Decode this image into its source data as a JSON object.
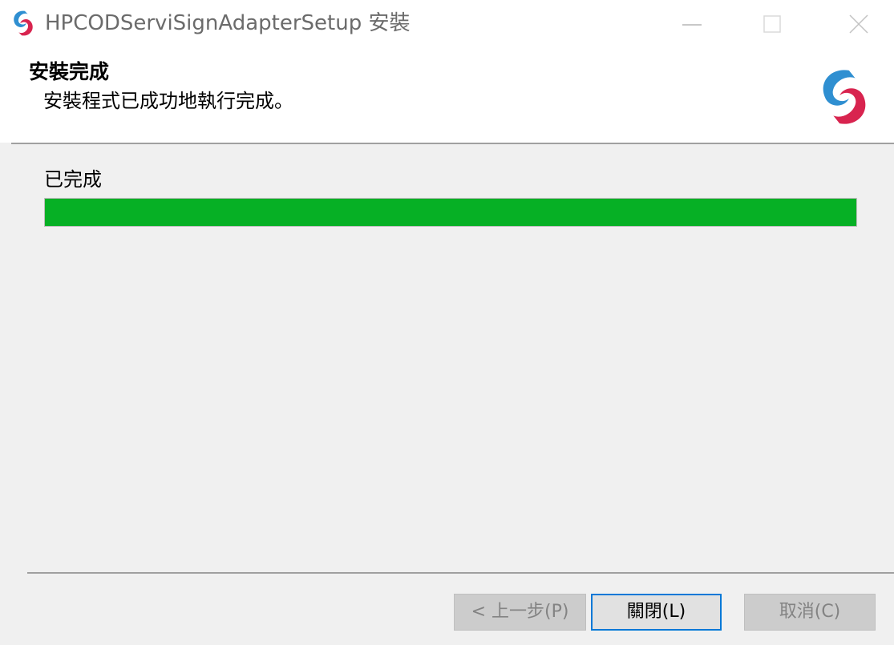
{
  "window": {
    "title": "HPCODServiSignAdapterSetup 安裝"
  },
  "header": {
    "title": "安裝完成",
    "subtitle": "安裝程式已成功地執行完成。"
  },
  "progress": {
    "label": "已完成",
    "percent": 100,
    "color": "#06b025"
  },
  "buttons": {
    "back_label": "< 上一步(P)",
    "close_label": "關閉(L)",
    "cancel_label": "取消(C)"
  },
  "colors": {
    "logo_blue": "#2f8fd1",
    "logo_red": "#d8244f",
    "focus_border": "#0078d7"
  }
}
